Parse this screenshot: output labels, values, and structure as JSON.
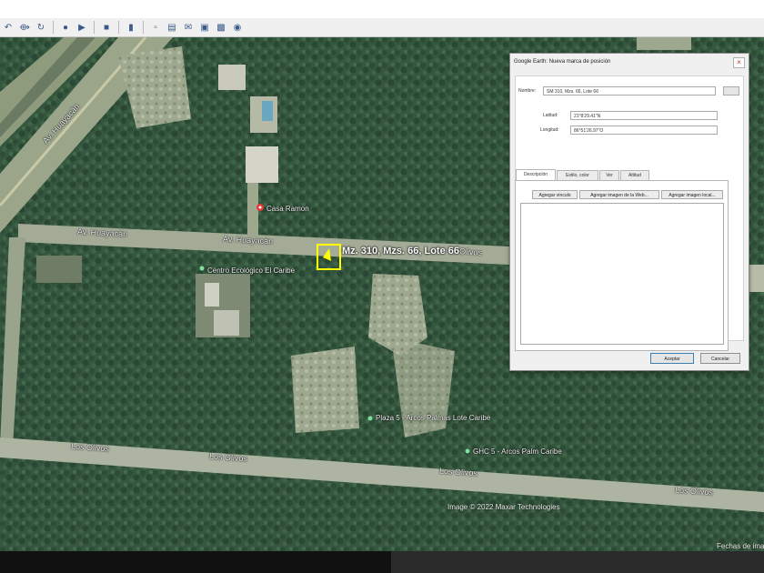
{
  "toolbar": {
    "icons": [
      "pointer-icon",
      "polygon-icon",
      "path-icon",
      "overlay-icon",
      "tour-icon",
      "history-icon",
      "sun-icon",
      "planets-icon",
      "ruler-icon",
      "email-icon",
      "print-icon",
      "save-image-icon",
      "maps-icon"
    ]
  },
  "map": {
    "roads": {
      "highway": "Av. Huayacán",
      "road_top_left": "Av. Huayacán",
      "road_top_center": "Av. Huayacán",
      "los_olivos_1": "Los Olivos",
      "los_olivos_2": "Los Olivos",
      "los_olivos_3": "Los Olivos",
      "los_olivos_4": "Los Olivos",
      "road_right_end": "Olivos"
    },
    "pois": {
      "casa_ramon": "Casa Ramon",
      "centro": "Centro Ecológico El Caribe",
      "plaza": "Plaza 5 - Arcos Palmas Lote Caribe",
      "market": "GHC 5 - Arcos Palm Caribe"
    },
    "placemark": {
      "label": "Mz. 310, Mzs. 66, Lote 66"
    },
    "copyright": "Image © 2022 Maxar Technologies",
    "imagery_date": "Fechas de imag"
  },
  "dialog": {
    "title": "Google Earth: Nueva marca de posición",
    "close_glyph": "×",
    "name_label": "Nombre:",
    "name_value": "SM 310, Mzs. 66, Lote 66",
    "latitude_label": "Latitud:",
    "latitude_value": "21°8'29.41\"N",
    "longitude_label": "Longitud:",
    "longitude_value": "86°51'26.97\"O",
    "tabs": [
      {
        "label": "Descripción",
        "active": true
      },
      {
        "label": "Estilo, color",
        "active": false
      },
      {
        "label": "Ver",
        "active": false
      },
      {
        "label": "Altitud",
        "active": false
      }
    ],
    "panel_buttons": [
      "Agregar vínculo",
      "Agregar imagen de la Web...",
      "Agregar imagen local..."
    ],
    "accept": "Aceptar",
    "cancel": "Cancelar"
  }
}
